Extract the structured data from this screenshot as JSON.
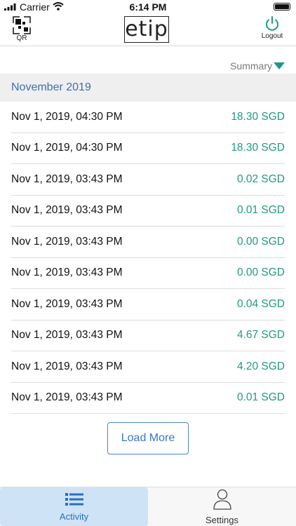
{
  "status_bar": {
    "carrier": "Carrier",
    "time": "6:14 PM"
  },
  "header": {
    "qr_label": "QR",
    "logo_text": "etip",
    "logout_label": "Logout"
  },
  "summary": {
    "label": "Summary"
  },
  "month": {
    "label": "November 2019"
  },
  "transactions": [
    {
      "date": "Nov 1, 2019, 04:30 PM",
      "amount": "18.30 SGD"
    },
    {
      "date": "Nov 1, 2019, 04:30 PM",
      "amount": "18.30 SGD"
    },
    {
      "date": "Nov 1, 2019, 03:43 PM",
      "amount": "0.02 SGD"
    },
    {
      "date": "Nov 1, 2019, 03:43 PM",
      "amount": "0.01 SGD"
    },
    {
      "date": "Nov 1, 2019, 03:43 PM",
      "amount": "0.00 SGD"
    },
    {
      "date": "Nov 1, 2019, 03:43 PM",
      "amount": "0.00 SGD"
    },
    {
      "date": "Nov 1, 2019, 03:43 PM",
      "amount": "0.04 SGD"
    },
    {
      "date": "Nov 1, 2019, 03:43 PM",
      "amount": "4.67 SGD"
    },
    {
      "date": "Nov 1, 2019, 03:43 PM",
      "amount": "4.20 SGD"
    },
    {
      "date": "Nov 1, 2019, 03:43 PM",
      "amount": "0.01 SGD"
    }
  ],
  "load_more": {
    "label": "Load More"
  },
  "tabs": [
    {
      "label": "Activity",
      "icon": "list-icon",
      "active": true
    },
    {
      "label": "Settings",
      "icon": "person-icon",
      "active": false
    }
  ],
  "colors": {
    "accent": "#1f9a82",
    "link": "#3a78c0",
    "month": "#3f6fb0",
    "active_tab_bg": "#cfe3f7"
  }
}
